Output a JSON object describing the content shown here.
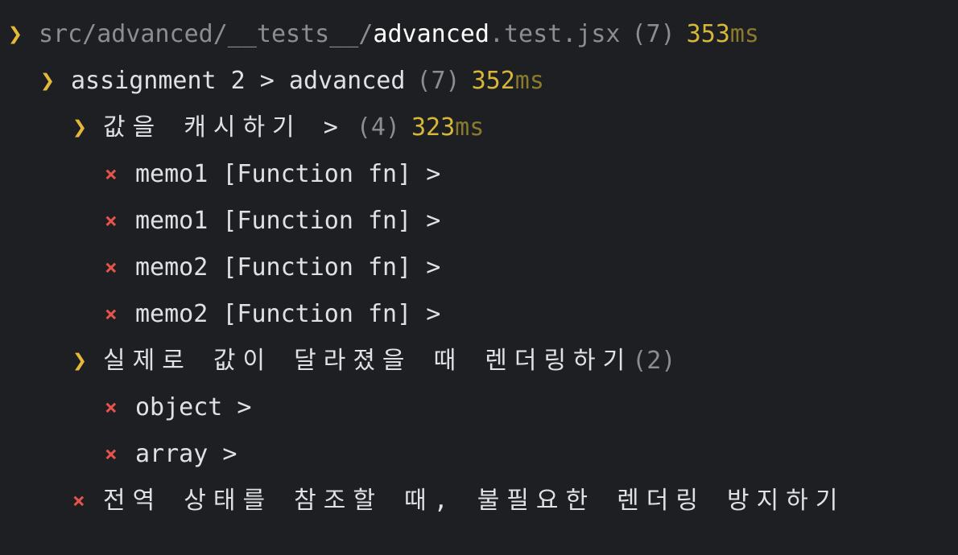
{
  "colors": {
    "background": "#1e1f22",
    "chevron": "#e5b83b",
    "fail_cross": "#e5534b",
    "dim_text": "#8b8d93",
    "duration": "#d7b73a",
    "duration_unit": "#8a7a2d"
  },
  "icons": {
    "chevron": "❯",
    "cross": "×"
  },
  "file_line": {
    "path_dim": "src/advanced/__tests__/",
    "file_name": "advanced",
    "file_ext": ".test.jsx",
    "count": "(7)",
    "duration_num": "353",
    "duration_unit": "ms"
  },
  "suite_line": {
    "label": "assignment 2 > advanced",
    "count": "(7)",
    "duration_num": "352",
    "duration_unit": "ms"
  },
  "group1": {
    "label": "값을 캐시하기 >",
    "count": "(4)",
    "duration_num": "323",
    "duration_unit": "ms",
    "tests": [
      "memo1 [Function fn] >",
      "memo1 [Function fn] >",
      "memo2 [Function fn] >",
      "memo2 [Function fn] >"
    ]
  },
  "group2": {
    "label": "실제로 값이 달라졌을 때 렌더링하기",
    "count": "(2)",
    "tests": [
      "object >",
      "array >"
    ]
  },
  "group3": {
    "label": "전역 상태를 참조할 때, 불필요한 렌더링 방지하기"
  }
}
